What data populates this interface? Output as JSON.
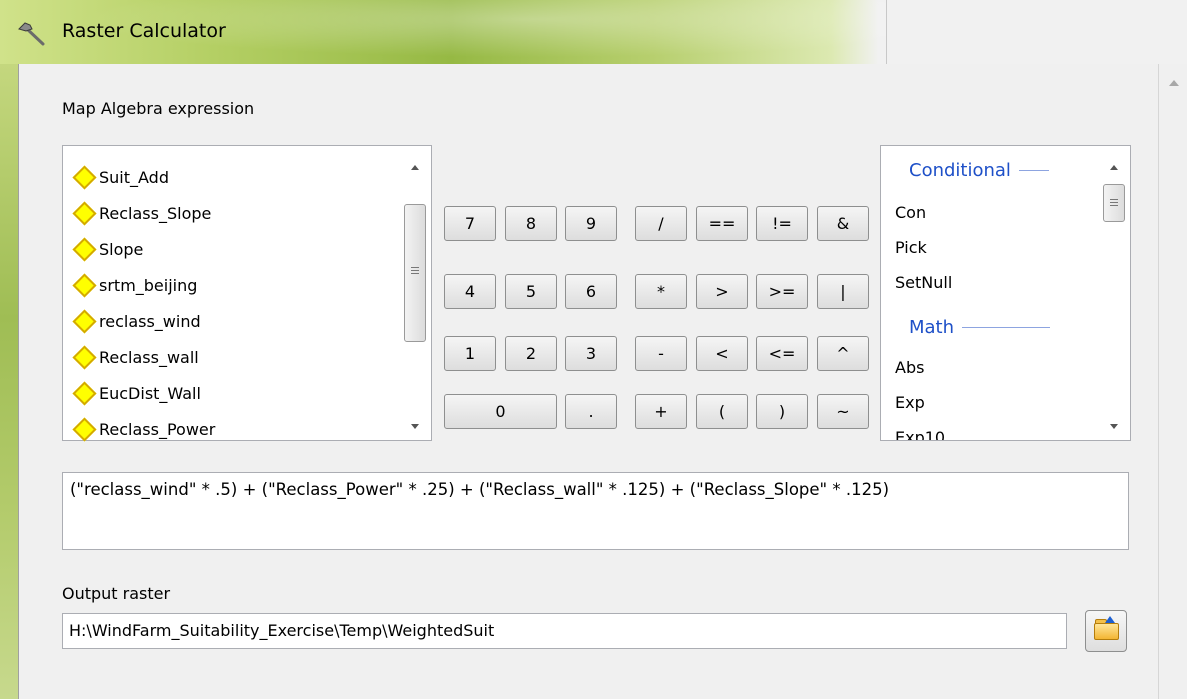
{
  "window": {
    "title": "Raster Calculator"
  },
  "expression_section": {
    "label": "Map Algebra expression"
  },
  "layers": [
    "Suit_Add",
    "Reclass_Slope",
    "Slope",
    "srtm_beijing",
    "reclass_wind",
    "Reclass_wall",
    "EucDist_Wall",
    "Reclass_Power"
  ],
  "buttons": {
    "b7": "7",
    "b8": "8",
    "b9": "9",
    "div": "/",
    "eq": "==",
    "neq": "!=",
    "and": "&",
    "b4": "4",
    "b5": "5",
    "b6": "6",
    "mul": "*",
    "gt": ">",
    "gte": ">=",
    "or": "|",
    "b1": "1",
    "b2": "2",
    "b3": "3",
    "sub": "-",
    "lt": "<",
    "lte": "<=",
    "xor": "^",
    "b0": "0",
    "dot": ".",
    "add": "+",
    "lparen": "(",
    "rparen": ")",
    "not": "~"
  },
  "functions": {
    "conditional_header": "Conditional",
    "conditional": [
      "Con",
      "Pick",
      "SetNull"
    ],
    "math_header": "Math",
    "math": [
      "Abs",
      "Exp",
      "Exp10"
    ]
  },
  "expression": "(\"reclass_wind\" * .5) + (\"Reclass_Power\" * .25) + (\"Reclass_wall\" * .125) + (\"Reclass_Slope\" * .125)",
  "output": {
    "label": "Output raster",
    "value": "H:\\WindFarm_Suitability_Exercise\\Temp\\WeightedSuit"
  }
}
